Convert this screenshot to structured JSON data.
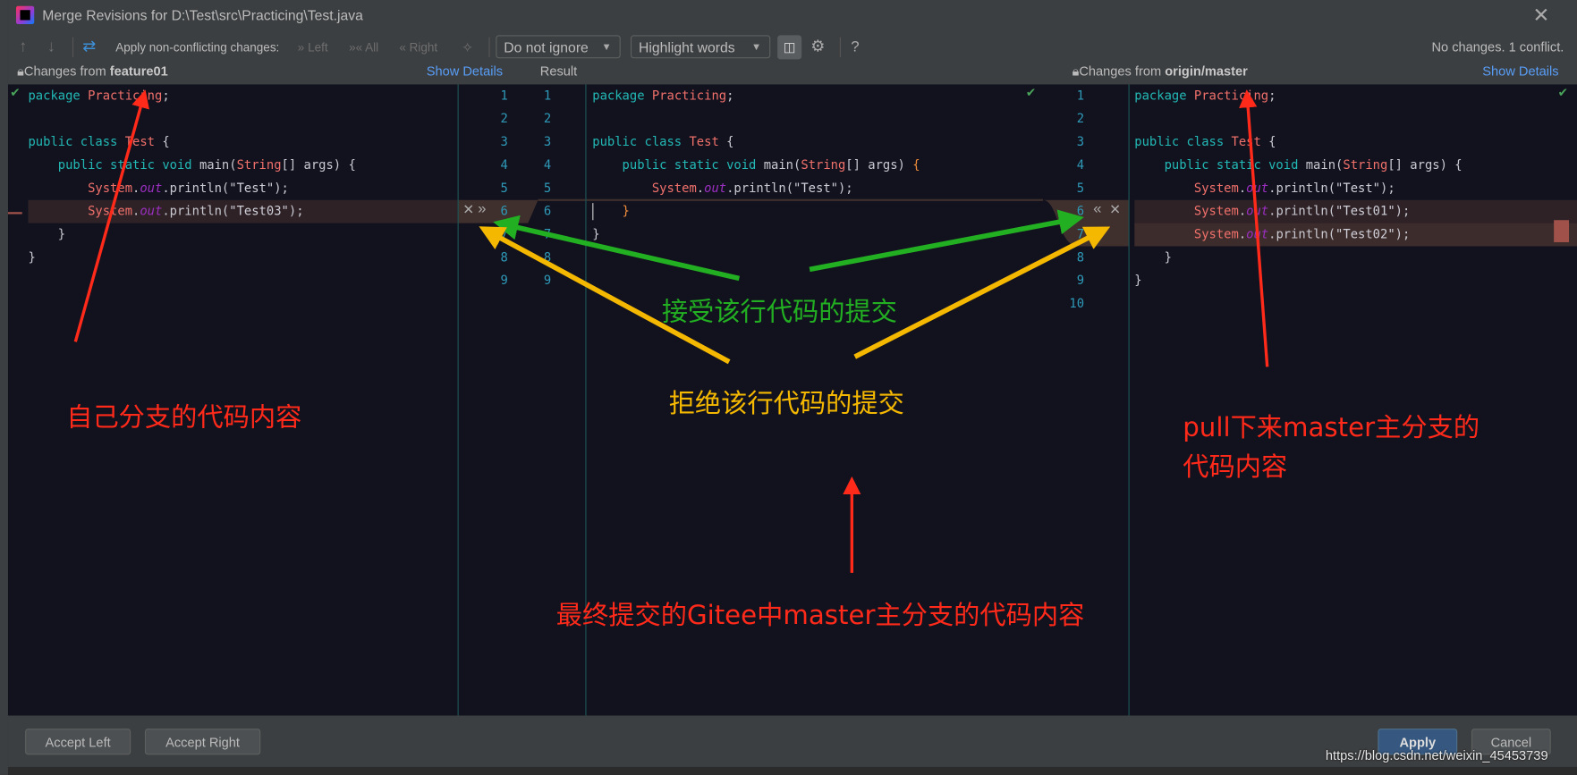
{
  "window": {
    "title": "Merge Revisions for D:\\Test\\src\\Practicing\\Test.java",
    "close_icon": "close-icon"
  },
  "toolbar": {
    "apply_label": "Apply non-conflicting changes:",
    "left": "» Left",
    "all": "»« All",
    "right": "« Right",
    "ignore_select": "Do not ignore",
    "highlight_select": "Highlight words",
    "help": "?",
    "status": "No changes. 1 conflict."
  },
  "panes": {
    "left": {
      "prefix": "Changes from ",
      "branch": "feature01",
      "show_details": "Show Details"
    },
    "result": {
      "label": "Result"
    },
    "right": {
      "prefix": "Changes from ",
      "branch": "origin/master",
      "show_details": "Show Details"
    }
  },
  "code": {
    "left": [
      [
        [
          "package ",
          "kw"
        ],
        [
          "Practicing",
          "id"
        ],
        [
          ";",
          ""
        ]
      ],
      [],
      [
        [
          "public class ",
          "kw"
        ],
        [
          "Test",
          "id"
        ],
        [
          " {",
          ""
        ]
      ],
      [
        [
          "    public static void ",
          "kw"
        ],
        [
          "main(",
          ""
        ],
        [
          "String",
          "id"
        ],
        [
          "[] args) {",
          ""
        ]
      ],
      [
        [
          "        System",
          "id"
        ],
        [
          ".",
          ""
        ],
        [
          "out",
          "out"
        ],
        [
          ".println(",
          ""
        ],
        [
          "\"Test\"",
          "str"
        ],
        [
          ");",
          ""
        ]
      ],
      [
        [
          "        System",
          "id"
        ],
        [
          ".",
          ""
        ],
        [
          "out",
          "out"
        ],
        [
          ".println(",
          ""
        ],
        [
          "\"Test03\"",
          "str"
        ],
        [
          ");",
          ""
        ]
      ],
      [
        [
          "    }",
          ""
        ]
      ],
      [
        [
          "}",
          ""
        ]
      ]
    ],
    "result": [
      [
        [
          "package ",
          "kw"
        ],
        [
          "Practicing",
          "id"
        ],
        [
          ";",
          ""
        ]
      ],
      [],
      [
        [
          "public class ",
          "kw"
        ],
        [
          "Test",
          "id"
        ],
        [
          " {",
          ""
        ]
      ],
      [
        [
          "    public static void ",
          "kw"
        ],
        [
          "main(",
          ""
        ],
        [
          "String",
          "id"
        ],
        [
          "[] args) ",
          ""
        ],
        [
          "{",
          "br"
        ]
      ],
      [
        [
          "        System",
          "id"
        ],
        [
          ".",
          ""
        ],
        [
          "out",
          "out"
        ],
        [
          ".println(",
          ""
        ],
        [
          "\"Test\"",
          "str"
        ],
        [
          ");",
          ""
        ]
      ],
      [
        [
          "    }",
          "br"
        ]
      ],
      [
        [
          "}",
          ""
        ]
      ]
    ],
    "right": [
      [
        [
          "package ",
          "kw"
        ],
        [
          "Practicing",
          "id"
        ],
        [
          ";",
          ""
        ]
      ],
      [],
      [
        [
          "public class ",
          "kw"
        ],
        [
          "Test",
          "id"
        ],
        [
          " {",
          ""
        ]
      ],
      [
        [
          "    public static void ",
          "kw"
        ],
        [
          "main(",
          ""
        ],
        [
          "String",
          "id"
        ],
        [
          "[] args) {",
          ""
        ]
      ],
      [
        [
          "        System",
          "id"
        ],
        [
          ".",
          ""
        ],
        [
          "out",
          "out"
        ],
        [
          ".println(",
          ""
        ],
        [
          "\"Test\"",
          "str"
        ],
        [
          ");",
          ""
        ]
      ],
      [
        [
          "        System",
          "id"
        ],
        [
          ".",
          ""
        ],
        [
          "out",
          "out"
        ],
        [
          ".println(",
          ""
        ],
        [
          "\"Test01\"",
          "str"
        ],
        [
          ");",
          ""
        ]
      ],
      [
        [
          "        System",
          "id"
        ],
        [
          ".",
          ""
        ],
        [
          "out",
          "out"
        ],
        [
          ".println(",
          ""
        ],
        [
          "\"Test02\"",
          "str"
        ],
        [
          ");",
          ""
        ]
      ],
      [
        [
          "    }",
          ""
        ]
      ],
      [
        [
          "}",
          ""
        ]
      ]
    ],
    "left_numbers": [
      "1",
      "2",
      "3",
      "4",
      "5",
      "6",
      "7",
      "8",
      "9"
    ],
    "result_numbers": [
      "1",
      "2",
      "3",
      "4",
      "5",
      "6",
      "7",
      "8",
      "9"
    ],
    "right_numbers": [
      "1",
      "2",
      "3",
      "4",
      "5",
      "6",
      "7",
      "8",
      "9",
      "10"
    ]
  },
  "footer": {
    "accept_left": "Accept Left",
    "accept_right": "Accept Right",
    "apply": "Apply",
    "cancel": "Cancel"
  },
  "watermark": "https://blog.csdn.net/weixin_45453739",
  "annotations": {
    "own_branch": "自己分支的代码内容",
    "accept": "接受该行代码的提交",
    "reject": "拒绝该行代码的提交",
    "master_line1": "pull下来master主分支的",
    "master_line2": "代码内容",
    "final": "最终提交的Gitee中master主分支的代码内容"
  },
  "colors": {
    "annotation_red": "#ff2a1a",
    "annotation_green": "#22b022",
    "annotation_yellow": "#f5b800",
    "accent": "#589df6"
  }
}
